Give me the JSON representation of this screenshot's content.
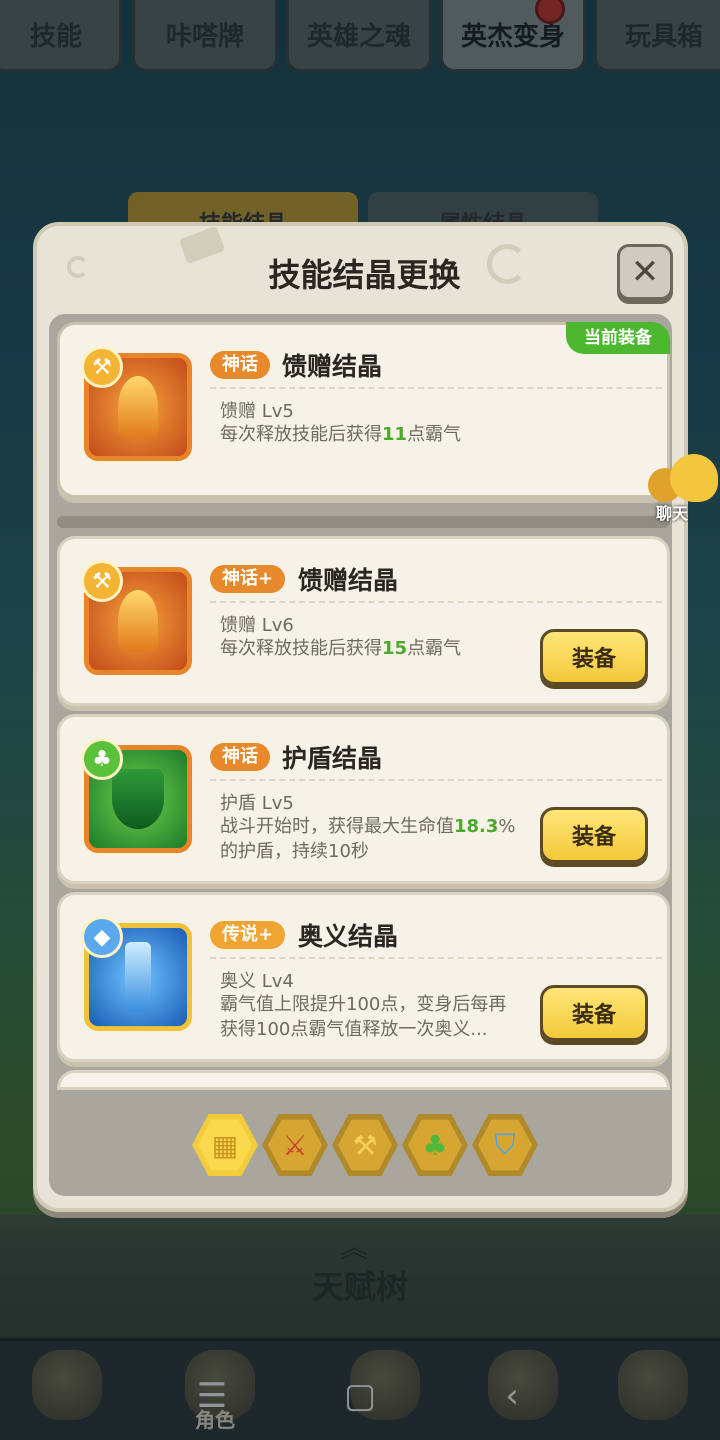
{
  "top_tabs": [
    {
      "label": "技能"
    },
    {
      "label": "咔嗒牌"
    },
    {
      "label": "英雄之魂"
    },
    {
      "label": "英杰变身"
    },
    {
      "label": "玩具箱"
    }
  ],
  "sub_tabs": {
    "left": "技能结晶",
    "right": "属性结晶"
  },
  "modal": {
    "title": "技能结晶更换",
    "close": "✕",
    "current_tag": "当前装备",
    "current": {
      "rarity": "神话",
      "name": "馈赠结晶",
      "level": "馈赠 Lv5",
      "desc_pre": "每次释放技能后获得",
      "desc_hl": "11",
      "desc_post": "点霸气"
    },
    "items": [
      {
        "rarity": "神话+",
        "name": "馈赠结晶",
        "level": "馈赠 Lv6",
        "desc_pre": "每次释放技能后获得",
        "desc_hl": "15",
        "desc_post": "点霸气",
        "button": "装备"
      },
      {
        "rarity": "神话",
        "name": "护盾结晶",
        "level": "护盾 Lv5",
        "desc_pre": "战斗开始时，获得最大生命值",
        "desc_hl": "18.3",
        "desc_post": "%的护盾，持续10秒",
        "button": "装备"
      },
      {
        "rarity": "传说+",
        "name": "奥义结晶",
        "level": "奥义 Lv4",
        "desc_pre": "霸气值上限提升100点，变身后每再获得100点霸气值释放一次奥义...",
        "desc_hl": "",
        "desc_post": "",
        "button": "装备"
      }
    ],
    "filters": [
      "grid-filter-icon",
      "sword-filter-icon",
      "axe-filter-icon",
      "leaf-filter-icon",
      "shield-filter-icon"
    ]
  },
  "chat": {
    "label": "聊天"
  },
  "talent": {
    "label": "天赋树"
  },
  "bottom_nav": {
    "label": "角色"
  },
  "colors": {
    "mythic": "#e8892b",
    "legend": "#f0a532",
    "highlight": "#4ea82f",
    "equip_button": "#f3c93b"
  }
}
